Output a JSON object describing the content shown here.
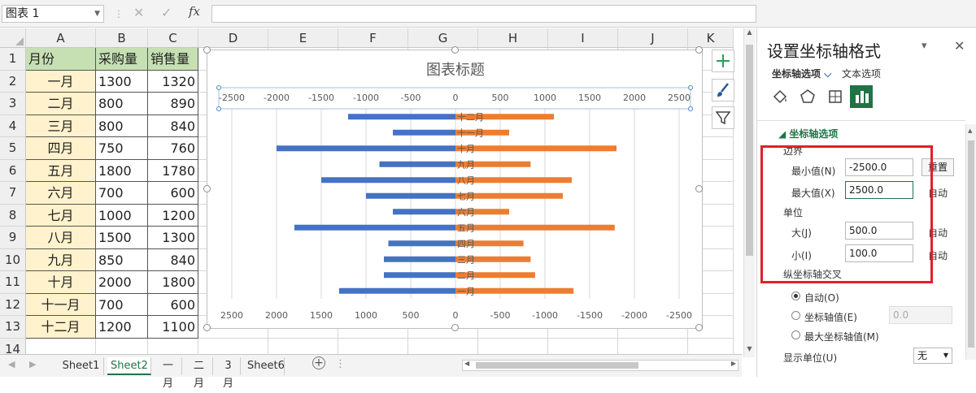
{
  "formula_bar": {
    "name_box": "图表 1",
    "fx": "fx"
  },
  "columns": [
    "A",
    "B",
    "C",
    "D",
    "E",
    "F",
    "G",
    "H",
    "I",
    "J",
    "K"
  ],
  "rows": [
    "1",
    "2",
    "3",
    "4",
    "5",
    "6",
    "7",
    "8",
    "9",
    "10",
    "11",
    "12",
    "13",
    "14"
  ],
  "table": {
    "headers": [
      "月份",
      "采购量",
      "销售量"
    ],
    "rows": [
      [
        "一月",
        "1300",
        "1320"
      ],
      [
        "二月",
        "800",
        "890"
      ],
      [
        "三月",
        "800",
        "840"
      ],
      [
        "四月",
        "750",
        "760"
      ],
      [
        "五月",
        "1800",
        "1780"
      ],
      [
        "六月",
        "700",
        "600"
      ],
      [
        "七月",
        "1000",
        "1200"
      ],
      [
        "八月",
        "1500",
        "1300"
      ],
      [
        "九月",
        "850",
        "840"
      ],
      [
        "十月",
        "2000",
        "1800"
      ],
      [
        "十一月",
        "700",
        "600"
      ],
      [
        "十二月",
        "1200",
        "1100"
      ]
    ]
  },
  "chart_data": {
    "type": "bar",
    "title": "图表标题",
    "categories": [
      "十二月",
      "十一月",
      "十月",
      "九月",
      "八月",
      "七月",
      "六月",
      "五月",
      "四月",
      "三月",
      "二月",
      "一月"
    ],
    "series": [
      {
        "values": [
          -1200,
          -700,
          -2000,
          -850,
          -1500,
          -1000,
          -700,
          -1800,
          -750,
          -800,
          -800,
          -1300
        ],
        "color": "#4472c4"
      },
      {
        "values": [
          1100,
          600,
          1800,
          840,
          1300,
          1200,
          600,
          1780,
          760,
          840,
          890,
          1320
        ],
        "color": "#ed7d31"
      }
    ],
    "top_axis_ticks": [
      "-2500",
      "-2000",
      "-1500",
      "-1000",
      "-500",
      "0",
      "500",
      "1000",
      "1500",
      "2000",
      "2500"
    ],
    "bottom_axis_ticks": [
      "2500",
      "2000",
      "1500",
      "1000",
      "500",
      "0",
      "-500",
      "-1000",
      "-1500",
      "-2000",
      "-2500"
    ],
    "xlim": [
      -2500,
      2500
    ],
    "grid": true
  },
  "sheet_tabs": [
    "Sheet1",
    "Sheet2",
    "一月",
    "二月",
    "3月",
    "Sheet6"
  ],
  "active_tab": "Sheet2",
  "pane": {
    "title": "设置坐标轴格式",
    "tab_axis": "坐标轴选项",
    "tab_text": "文本选项",
    "section": "坐标轴选项",
    "bounds": "边界",
    "min_label": "最小值(N)",
    "min_value": "-2500.0",
    "reset": "重置",
    "max_label": "最大值(X)",
    "max_value": "2500.0",
    "auto": "自动",
    "units": "单位",
    "major_label": "大(J)",
    "major_value": "500.0",
    "minor_label": "小(I)",
    "minor_value": "100.0",
    "cross": "纵坐标轴交叉",
    "opt_auto": "自动(O)",
    "opt_value": "坐标轴值(E)",
    "opt_value_num": "0.0",
    "opt_max": "最大坐标轴值(M)",
    "display_units": "显示单位(U)",
    "display_units_value": "无",
    "highlight_color": "#e0202a"
  }
}
